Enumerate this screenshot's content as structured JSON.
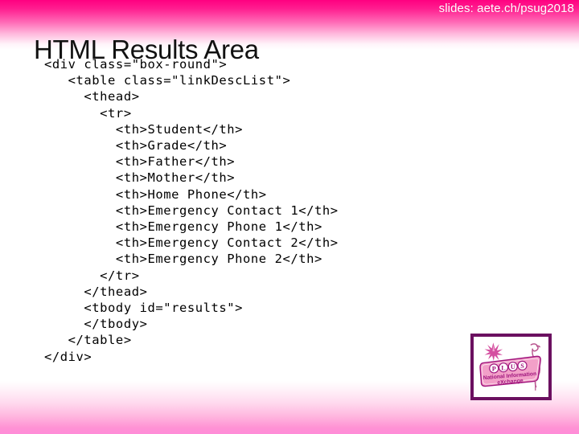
{
  "header": {
    "slides_url": "slides: aete.ch/psug2018",
    "title": "HTML Results Area"
  },
  "code": {
    "language": "html",
    "lines": [
      "<div class=\"box-round\">",
      "   <table class=\"linkDescList\">",
      "     <thead>",
      "       <tr>",
      "         <th>Student</th>",
      "         <th>Grade</th>",
      "         <th>Father</th>",
      "         <th>Mother</th>",
      "         <th>Home Phone</th>",
      "         <th>Emergency Contact 1</th>",
      "         <th>Emergency Phone 1</th>",
      "         <th>Emergency Contact 2</th>",
      "         <th>Emergency Phone 2</th>",
      "       </tr>",
      "     </thead>",
      "     <tbody id=\"results\">",
      "     </tbody>",
      "   </table>",
      "</div>"
    ]
  },
  "logo": {
    "name": "plus-national-information-exchange-logo",
    "sign_text": "PLUS",
    "sign_letters": [
      "P",
      "L",
      "U",
      "S"
    ],
    "tagline_line1": "National Information",
    "tagline_line2": "eXchange"
  },
  "colors": {
    "band_pink": "#ff0080",
    "band_pink_bottom": "#ff8cd8",
    "logo_border": "#6b1060",
    "logo_sign": "#f2a0c8",
    "logo_accent": "#a0157d",
    "title_text": "#111111",
    "code_text": "#000000",
    "url_text": "#ffffff"
  }
}
